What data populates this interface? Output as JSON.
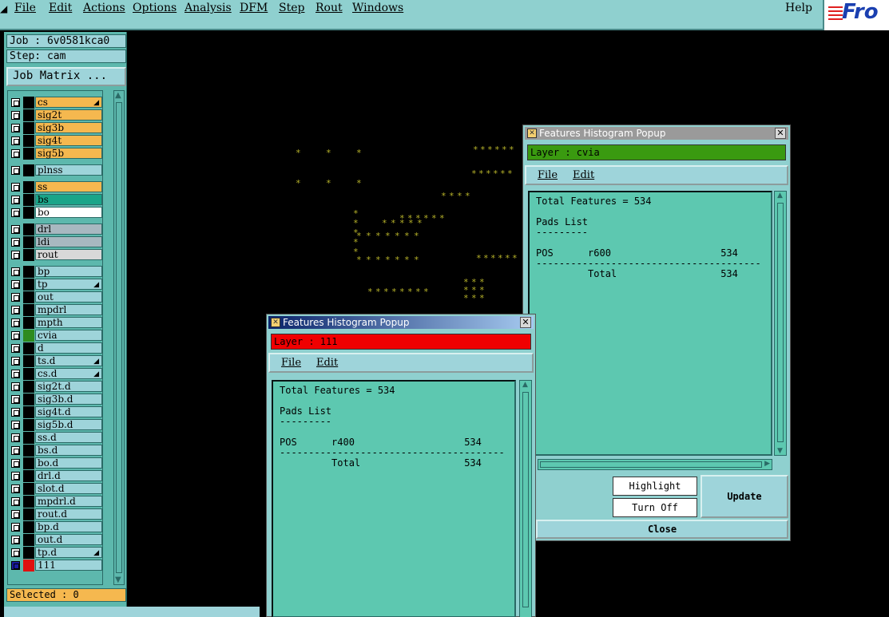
{
  "menubar": {
    "items": [
      "File",
      "Edit",
      "Actions",
      "Options",
      "Analysis",
      "DFM",
      "Step",
      "Rout",
      "Windows"
    ],
    "help": "Help",
    "logo_text": "Fro"
  },
  "left_panel": {
    "job": "Job : 6v0581kca0",
    "step": "Step: cam",
    "job_matrix_button": "Job Matrix ...",
    "selected": "Selected : 0",
    "layers": [
      {
        "name": "cs",
        "color": "#f5b84f",
        "mark": true
      },
      {
        "name": "sig2t",
        "color": "#f5b84f"
      },
      {
        "name": "sig3b",
        "color": "#f5b84f"
      },
      {
        "name": "sig4t",
        "color": "#f5b84f"
      },
      {
        "name": "sig5b",
        "color": "#f5b84f"
      },
      {
        "name": "plnss",
        "color": "#9ed4da"
      },
      {
        "name": "ss",
        "color": "#f5b84f"
      },
      {
        "name": "bs",
        "color": "#1aa589"
      },
      {
        "name": "bo",
        "color": "#ffffff"
      },
      {
        "name": "drl",
        "color": "#a8b8c0"
      },
      {
        "name": "ldi",
        "color": "#a8b8c0"
      },
      {
        "name": "rout",
        "color": "#d8d8d8"
      },
      {
        "name": "bp",
        "color": "#9ed4da"
      },
      {
        "name": "tp",
        "color": "#9ed4da",
        "mark": true
      },
      {
        "name": "out",
        "color": "#9ed4da"
      },
      {
        "name": "mpdrl",
        "color": "#9ed4da"
      },
      {
        "name": "mpth",
        "color": "#9ed4da"
      },
      {
        "name": "cvia",
        "color": "#9ed4da",
        "block": "#2e8b1e"
      },
      {
        "name": "d",
        "color": "#9ed4da"
      },
      {
        "name": "ts.d",
        "color": "#9ed4da",
        "mark": true
      },
      {
        "name": "cs.d",
        "color": "#9ed4da",
        "mark": true
      },
      {
        "name": "sig2t.d",
        "color": "#9ed4da"
      },
      {
        "name": "sig3b.d",
        "color": "#9ed4da"
      },
      {
        "name": "sig4t.d",
        "color": "#9ed4da"
      },
      {
        "name": "sig5b.d",
        "color": "#9ed4da"
      },
      {
        "name": "ss.d",
        "color": "#9ed4da"
      },
      {
        "name": "bs.d",
        "color": "#9ed4da"
      },
      {
        "name": "bo.d",
        "color": "#9ed4da"
      },
      {
        "name": "drl.d",
        "color": "#9ed4da"
      },
      {
        "name": "slot.d",
        "color": "#9ed4da"
      },
      {
        "name": "mpdrl.d",
        "color": "#9ed4da"
      },
      {
        "name": "rout.d",
        "color": "#9ed4da"
      },
      {
        "name": "bp.d",
        "color": "#9ed4da"
      },
      {
        "name": "out.d",
        "color": "#9ed4da"
      },
      {
        "name": "tp.d",
        "color": "#9ed4da",
        "mark": true
      },
      {
        "name": "111",
        "color": "#9ed4da",
        "block": "#e01010",
        "active": true
      }
    ]
  },
  "popup_cvia": {
    "title": "Features Histogram Popup",
    "layer": "Layer :  cvia",
    "layer_color": "#3a9a10",
    "menu": [
      "File",
      "Edit"
    ],
    "lines": [
      "Total Features = 534",
      "",
      "Pads List",
      "---------",
      "",
      "POS      r600                   534",
      "---------------------------------------",
      "         Total                  534"
    ],
    "highlight": "Highlight",
    "turn_off": "Turn Off",
    "update": "Update",
    "close": "Close"
  },
  "popup_111": {
    "title": "Features Histogram Popup",
    "layer": "Layer :  111",
    "layer_color": "#f00000",
    "menu": [
      "File",
      "Edit"
    ],
    "lines": [
      "Total Features = 534",
      "",
      "Pads List",
      "---------",
      "",
      "POS      r400                   534",
      "---------------------------------------",
      "         Total                  534"
    ]
  }
}
